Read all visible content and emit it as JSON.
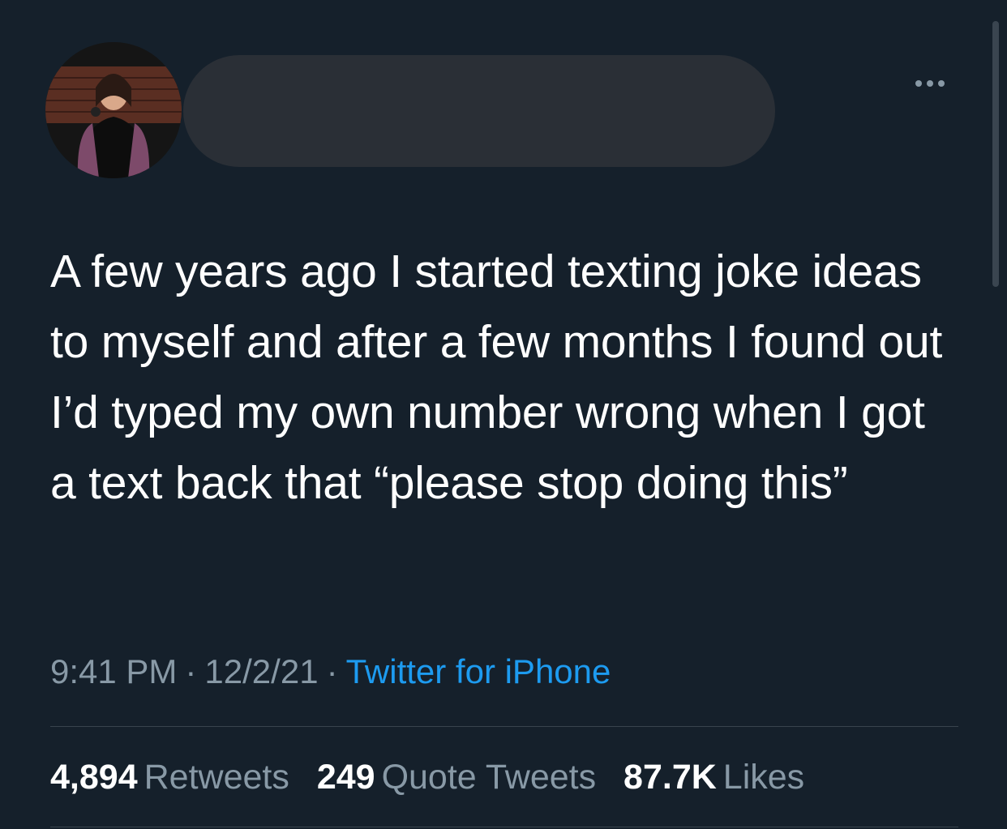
{
  "tweet": {
    "text": "A few years ago I started texting joke ideas to myself and after a few months I found out I’d typed my own number wrong when I got a text back that “please stop doing this”",
    "time": "9:41 PM",
    "separator": "·",
    "date": "12/2/21",
    "source": "Twitter for iPhone"
  },
  "stats": {
    "retweets": {
      "count": "4,894",
      "label": "Retweets"
    },
    "quotes": {
      "count": "249",
      "label": "Quote Tweets"
    },
    "likes": {
      "count": "87.7K",
      "label": "Likes"
    }
  },
  "icons": {
    "more": "more-horizontal-icon"
  },
  "colors": {
    "background": "#15202b",
    "text": "#ffffff",
    "secondary": "#8899a6",
    "link": "#1d9bf0",
    "divider": "#38444d"
  }
}
